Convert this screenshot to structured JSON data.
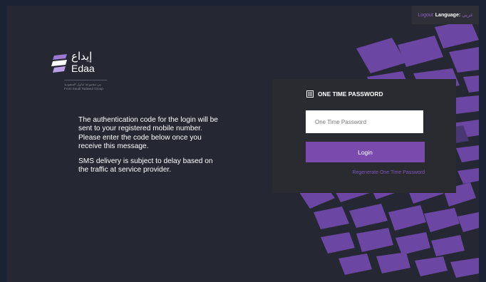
{
  "topbar": {
    "logout_label": "Logout",
    "language_label": "Language:",
    "language_value": "عربي"
  },
  "brand": {
    "name_arabic": "إيداع",
    "name_latin": "Edaa",
    "tagline_arabic": "من مجموعة تداول السعودية",
    "tagline_latin": "From Saudi Tadawul Group"
  },
  "info": {
    "paragraph1": "The authentication code for the login will be sent to your registered mobile number. Please enter the code below once you receive this message.",
    "paragraph2": "SMS delivery is subject to delay based on the traffic at service provider."
  },
  "panel": {
    "title": "ONE TIME PASSWORD",
    "title_icon": "keypad-icon",
    "otp_placeholder": "One Time Password",
    "otp_value": "",
    "login_label": "Login",
    "regenerate_label": "Regenerate One Time Password"
  },
  "colors": {
    "page_bg": "#252833",
    "accent_purple": "#7a4bad",
    "link_purple": "#8f63c7",
    "panel_bg": "#2a2b30"
  }
}
